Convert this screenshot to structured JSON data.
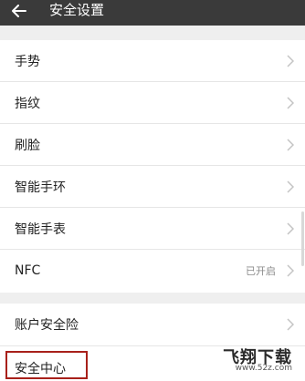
{
  "header": {
    "title": "安全设置",
    "back_icon": "arrow-left-icon"
  },
  "groups": [
    {
      "items": [
        {
          "label": "手势"
        },
        {
          "label": "指纹"
        },
        {
          "label": "刷脸"
        },
        {
          "label": "智能手环"
        },
        {
          "label": "智能手表"
        },
        {
          "label": "NFC",
          "status": "已开启"
        }
      ]
    },
    {
      "items": [
        {
          "label": "账户安全险"
        },
        {
          "label": "安全中心"
        }
      ]
    }
  ],
  "watermark": {
    "main": "飞翔下载",
    "sub": "www.52z.com"
  },
  "colors": {
    "header_bg": "#3a3a3a",
    "page_bg": "#efefef",
    "highlight": "#a8201a"
  }
}
